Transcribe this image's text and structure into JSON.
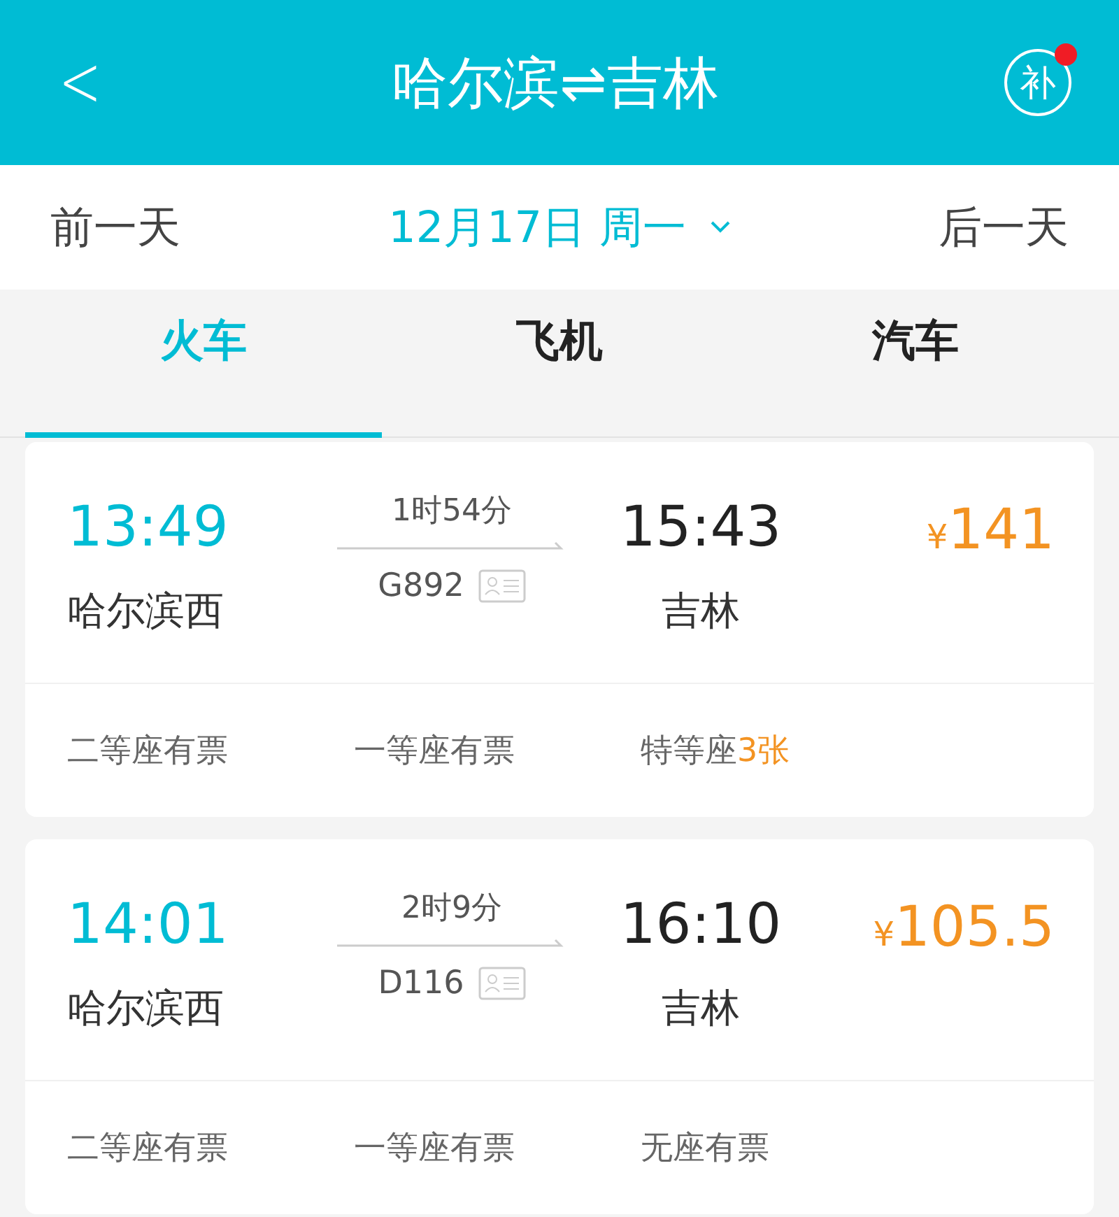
{
  "header": {
    "back": "<",
    "title": "哈尔滨⇌吉林",
    "badge_icon": "补",
    "badge_dot": true
  },
  "date_bar": {
    "prev": "前一天",
    "date": "12月17日 周一",
    "next": "后一天"
  },
  "tabs": [
    {
      "label": "火车",
      "selected": true
    },
    {
      "label": "飞机",
      "selected": false
    },
    {
      "label": "汽车",
      "selected": false
    }
  ],
  "trains": [
    {
      "depart_time": "13:49",
      "depart_station": "哈尔滨西",
      "duration": "1时54分",
      "number": "G892",
      "arrive_time": "15:43",
      "arrive_station": "吉林",
      "currency": "¥",
      "price": "141",
      "seats": [
        {
          "name": "二等座",
          "availability": "有票",
          "kind": "available"
        },
        {
          "name": "一等座",
          "availability": "有票",
          "kind": "available"
        },
        {
          "name": "特等座",
          "availability": "3张",
          "kind": "count"
        }
      ]
    },
    {
      "depart_time": "14:01",
      "depart_station": "哈尔滨西",
      "duration": "2时9分",
      "number": "D116",
      "arrive_time": "16:10",
      "arrive_station": "吉林",
      "currency": "¥",
      "price": "105.5",
      "seats": [
        {
          "name": "二等座",
          "availability": "有票",
          "kind": "available"
        },
        {
          "name": "一等座",
          "availability": "有票",
          "kind": "available"
        },
        {
          "name": "无座",
          "availability": "有票",
          "kind": "available"
        }
      ]
    }
  ]
}
